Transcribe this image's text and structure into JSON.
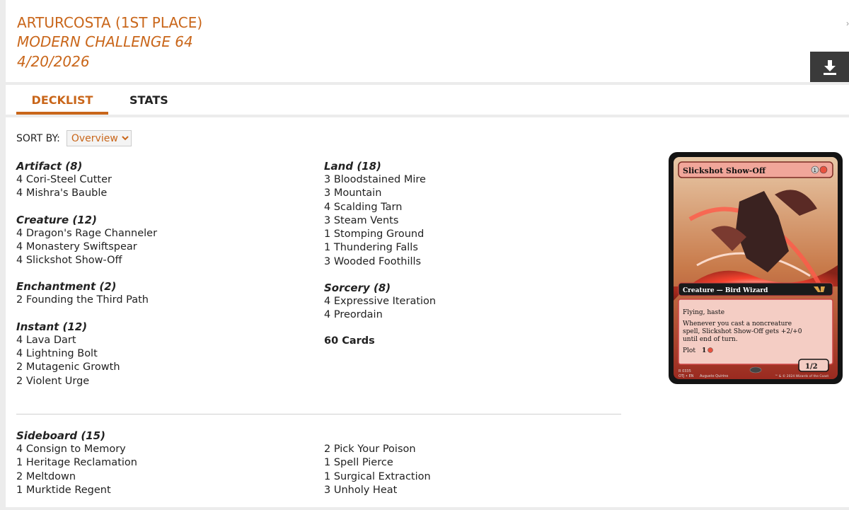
{
  "header": {
    "line1": "ARTURCOSTA (1ST PLACE)",
    "line2": "MODERN CHALLENGE 64",
    "line3": "4/20/2026",
    "download_icon": "download-icon"
  },
  "tabs": [
    {
      "label": "DECKLIST",
      "active": true
    },
    {
      "label": "STATS",
      "active": false
    }
  ],
  "sort": {
    "label": "SORT BY:",
    "selected": "Overview"
  },
  "left_column": [
    {
      "heading": "Artifact (8)",
      "cards": [
        "4 Cori-Steel Cutter",
        "4 Mishra's Bauble"
      ]
    },
    {
      "heading": "Creature (12)",
      "cards": [
        "4 Dragon's Rage Channeler",
        "4 Monastery Swiftspear",
        "4 Slickshot Show-Off"
      ]
    },
    {
      "heading": "Enchantment (2)",
      "cards": [
        "2 Founding the Third Path"
      ]
    },
    {
      "heading": "Instant (12)",
      "cards": [
        "4 Lava Dart",
        "4 Lightning Bolt",
        "2 Mutagenic Growth",
        "2 Violent Urge"
      ]
    }
  ],
  "right_column": [
    {
      "heading": "Land (18)",
      "cards": [
        "3 Bloodstained Mire",
        "3 Mountain",
        "4 Scalding Tarn",
        "3 Steam Vents",
        "1 Stomping Ground",
        "1 Thundering Falls",
        "3 Wooded Foothills"
      ]
    },
    {
      "heading": "Sorcery (8)",
      "cards": [
        "4 Expressive Iteration",
        "4 Preordain"
      ]
    }
  ],
  "total": "60 Cards",
  "sideboard": {
    "heading": "Sideboard (15)",
    "left": [
      "4 Consign to Memory",
      "1 Heritage Reclamation",
      "2 Meltdown",
      "1 Murktide Regent"
    ],
    "right": [
      "2 Pick Your Poison",
      "1 Spell Pierce",
      "1 Surgical Extraction",
      "3 Unholy Heat"
    ]
  },
  "card_preview": {
    "name": "Slickshot Show-Off",
    "type_line": "Creature — Bird Wizard",
    "rules1": "Flying, haste",
    "rules2a": "Whenever you cast a noncreature",
    "rules2b": "spell, Slickshot Show-Off gets +2/+0",
    "rules2c": "until end of turn.",
    "plot": "Plot",
    "plot_cost": "1",
    "pt": "1/2",
    "footer1": "R 0335",
    "footer2": "OTJ • EN",
    "artist": "Augusto Quirino",
    "copyright": "™ & © 2024 Wizards of the Coast"
  },
  "colors": {
    "accent": "#c9661a",
    "card_frame": "#1a1a1a",
    "card_red": "#d9534a"
  }
}
